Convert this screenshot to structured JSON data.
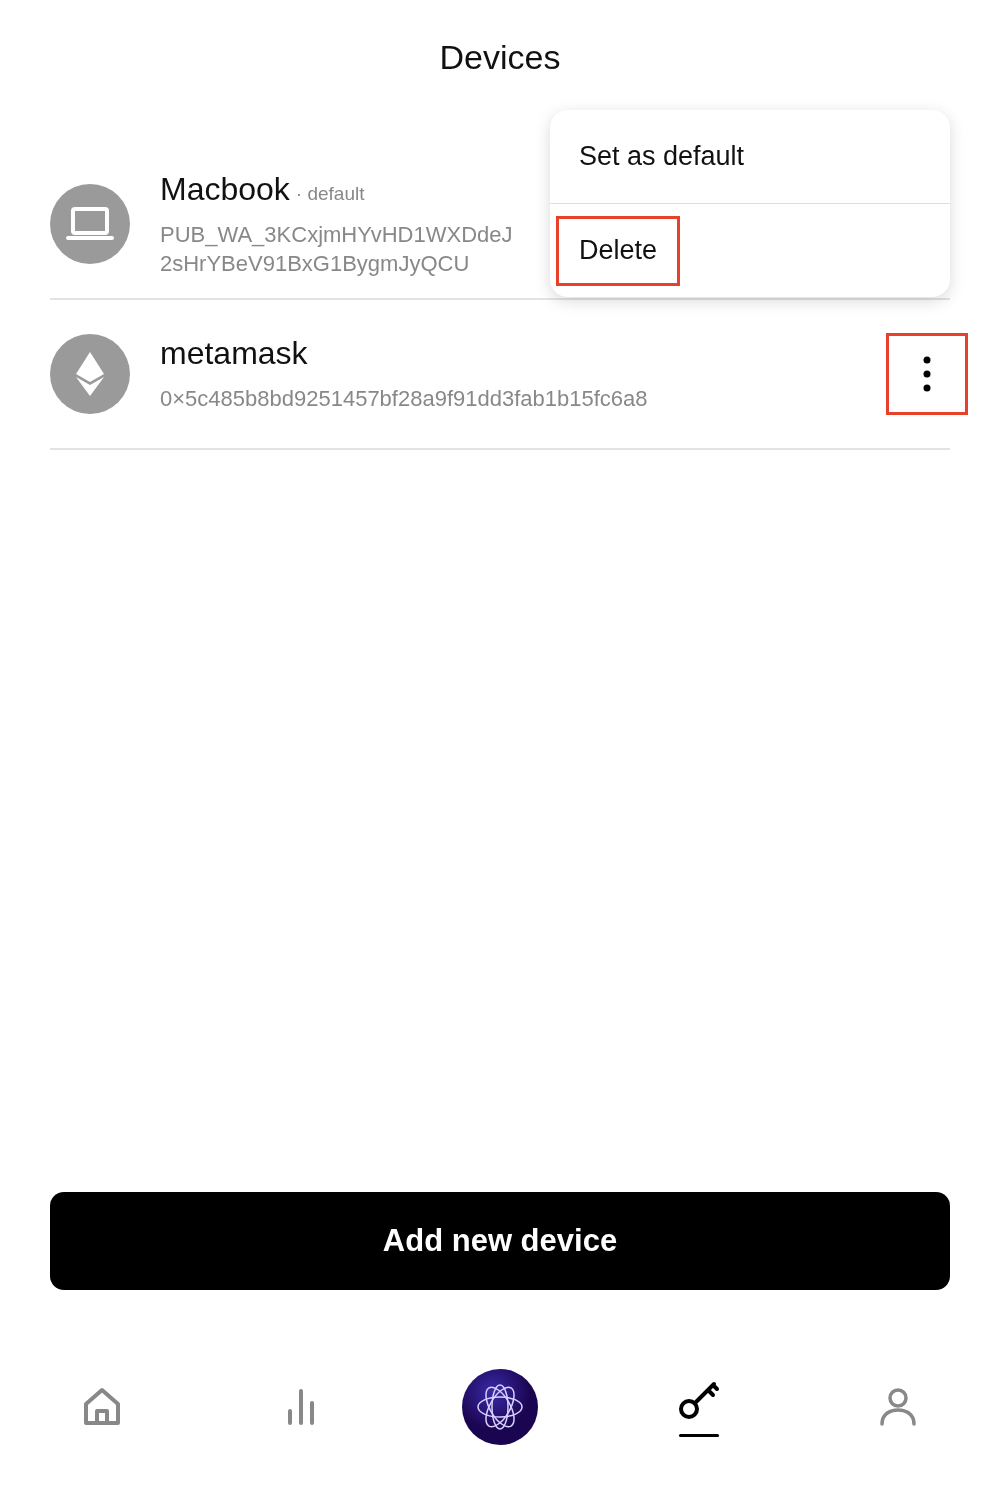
{
  "title": "Devices",
  "devices": [
    {
      "name": "Macbook",
      "badge": "· default",
      "kind": "laptop",
      "key_lines": [
        "PUB_WA_3KCxjmHYvHD1WXDdeJ",
        "2sHrYBeV91BxG1BygmJyQCU"
      ]
    },
    {
      "name": "metamask",
      "kind": "ethereum",
      "key_lines": [
        "0×5c485b8bd9251457bf28a9f91dd3fab1b15fc6a8"
      ],
      "more_highlighted": true
    }
  ],
  "menu": {
    "items": [
      {
        "label": "Set as default",
        "highlighted": false
      },
      {
        "label": "Delete",
        "highlighted": true
      }
    ]
  },
  "add_button": "Add new device",
  "nav": [
    {
      "kind": "home",
      "selected": false
    },
    {
      "kind": "stats",
      "selected": false
    },
    {
      "kind": "logo",
      "selected": false
    },
    {
      "kind": "key",
      "selected": true
    },
    {
      "kind": "profile",
      "selected": false
    }
  ]
}
